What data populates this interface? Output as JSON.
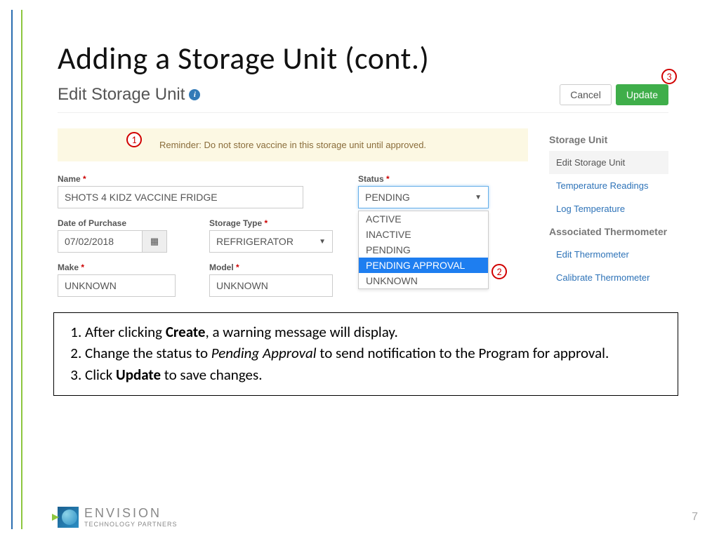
{
  "slide": {
    "title": "Adding a Storage Unit (cont.)",
    "page_number": "7"
  },
  "app": {
    "header_title": "Edit Storage Unit",
    "cancel_label": "Cancel",
    "update_label": "Update",
    "alert_text": "Reminder: Do not store vaccine in this storage unit until approved."
  },
  "form": {
    "name_label": "Name",
    "name_value": "SHOTS 4 KIDZ VACCINE FRIDGE",
    "status_label": "Status",
    "status_value": "PENDING",
    "status_options": {
      "o0": "ACTIVE",
      "o1": "INACTIVE",
      "o2": "PENDING",
      "o3": "PENDING APPROVAL",
      "o4": "UNKNOWN"
    },
    "date_label": "Date of Purchase",
    "date_value": "07/02/2018",
    "type_label": "Storage Type",
    "type_value": "REFRIGERATOR",
    "make_label": "Make",
    "make_value": "UNKNOWN",
    "model_label": "Model",
    "model_value": "UNKNOWN"
  },
  "sidebar": {
    "section1": "Storage Unit",
    "item1": "Edit Storage Unit",
    "item2": "Temperature Readings",
    "item3": "Log Temperature",
    "section2": "Associated Thermometer",
    "item4": "Edit Thermometer",
    "item5": "Calibrate Thermometer"
  },
  "callouts": {
    "c1": "1",
    "c2": "2",
    "c3": "3"
  },
  "notes": {
    "n1a": "After clicking ",
    "n1b": "Create",
    "n1c": ", a warning message will display.",
    "n2a": "Change the status to ",
    "n2b": "Pending Approval",
    "n2c": " to send notification to the Program for approval.",
    "n3a": "Click ",
    "n3b": "Update",
    "n3c": " to save changes."
  },
  "logo": {
    "line1": "ENVISION",
    "line2": "TECHNOLOGY PARTNERS"
  }
}
